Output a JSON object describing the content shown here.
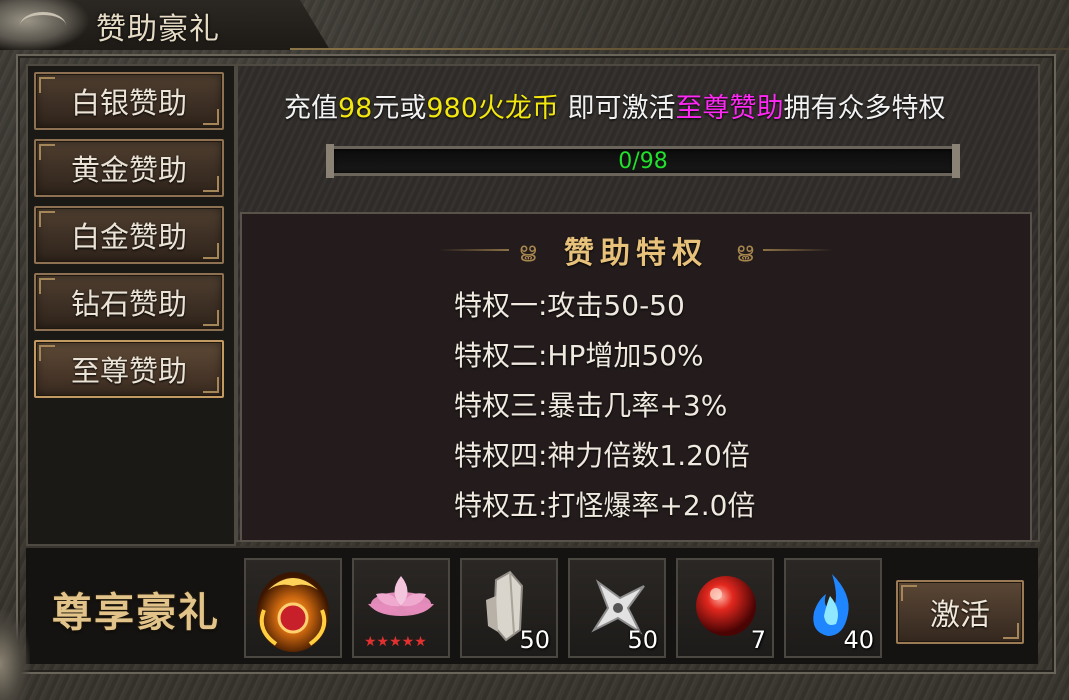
{
  "window": {
    "title": "赞助豪礼"
  },
  "sidebar": {
    "items": [
      {
        "label": "白银赞助"
      },
      {
        "label": "黄金赞助"
      },
      {
        "label": "白金赞助"
      },
      {
        "label": "钻石赞助"
      },
      {
        "label": "至尊赞助"
      }
    ],
    "selected_index": 4
  },
  "promo": {
    "part1": "充值",
    "amount_yuan": "98",
    "part2": "元或",
    "amount_coin": "980火龙币",
    "part3": " 即可激活",
    "tier": "至尊赞助",
    "part4": "拥有众多特权"
  },
  "progress": {
    "text": "0/98",
    "current": 0,
    "max": 98
  },
  "privileges": {
    "title": "赞助特权",
    "items": [
      "特权一:攻击50-50",
      "特权二:HP增加50%",
      "特权三:暴击几率+3%",
      "特权四:神力倍数1.20倍",
      "特权五:打怪爆率+2.0倍"
    ]
  },
  "rewards": {
    "label": "尊享豪礼",
    "items": [
      {
        "icon": "golden-dragon-medal-icon",
        "count": ""
      },
      {
        "icon": "pink-lotus-icon",
        "count": "",
        "stars": 5
      },
      {
        "icon": "silver-crystal-icon",
        "count": "50"
      },
      {
        "icon": "silver-shuriken-icon",
        "count": "50"
      },
      {
        "icon": "red-orb-icon",
        "count": "7"
      },
      {
        "icon": "blue-flame-icon",
        "count": "40"
      }
    ]
  },
  "actions": {
    "activate_label": "激活"
  },
  "colors": {
    "highlight_yellow": "#f2e70e",
    "highlight_magenta": "#ff28f4",
    "progress_text": "#22e02c",
    "gold_accent": "#e2c48a"
  }
}
